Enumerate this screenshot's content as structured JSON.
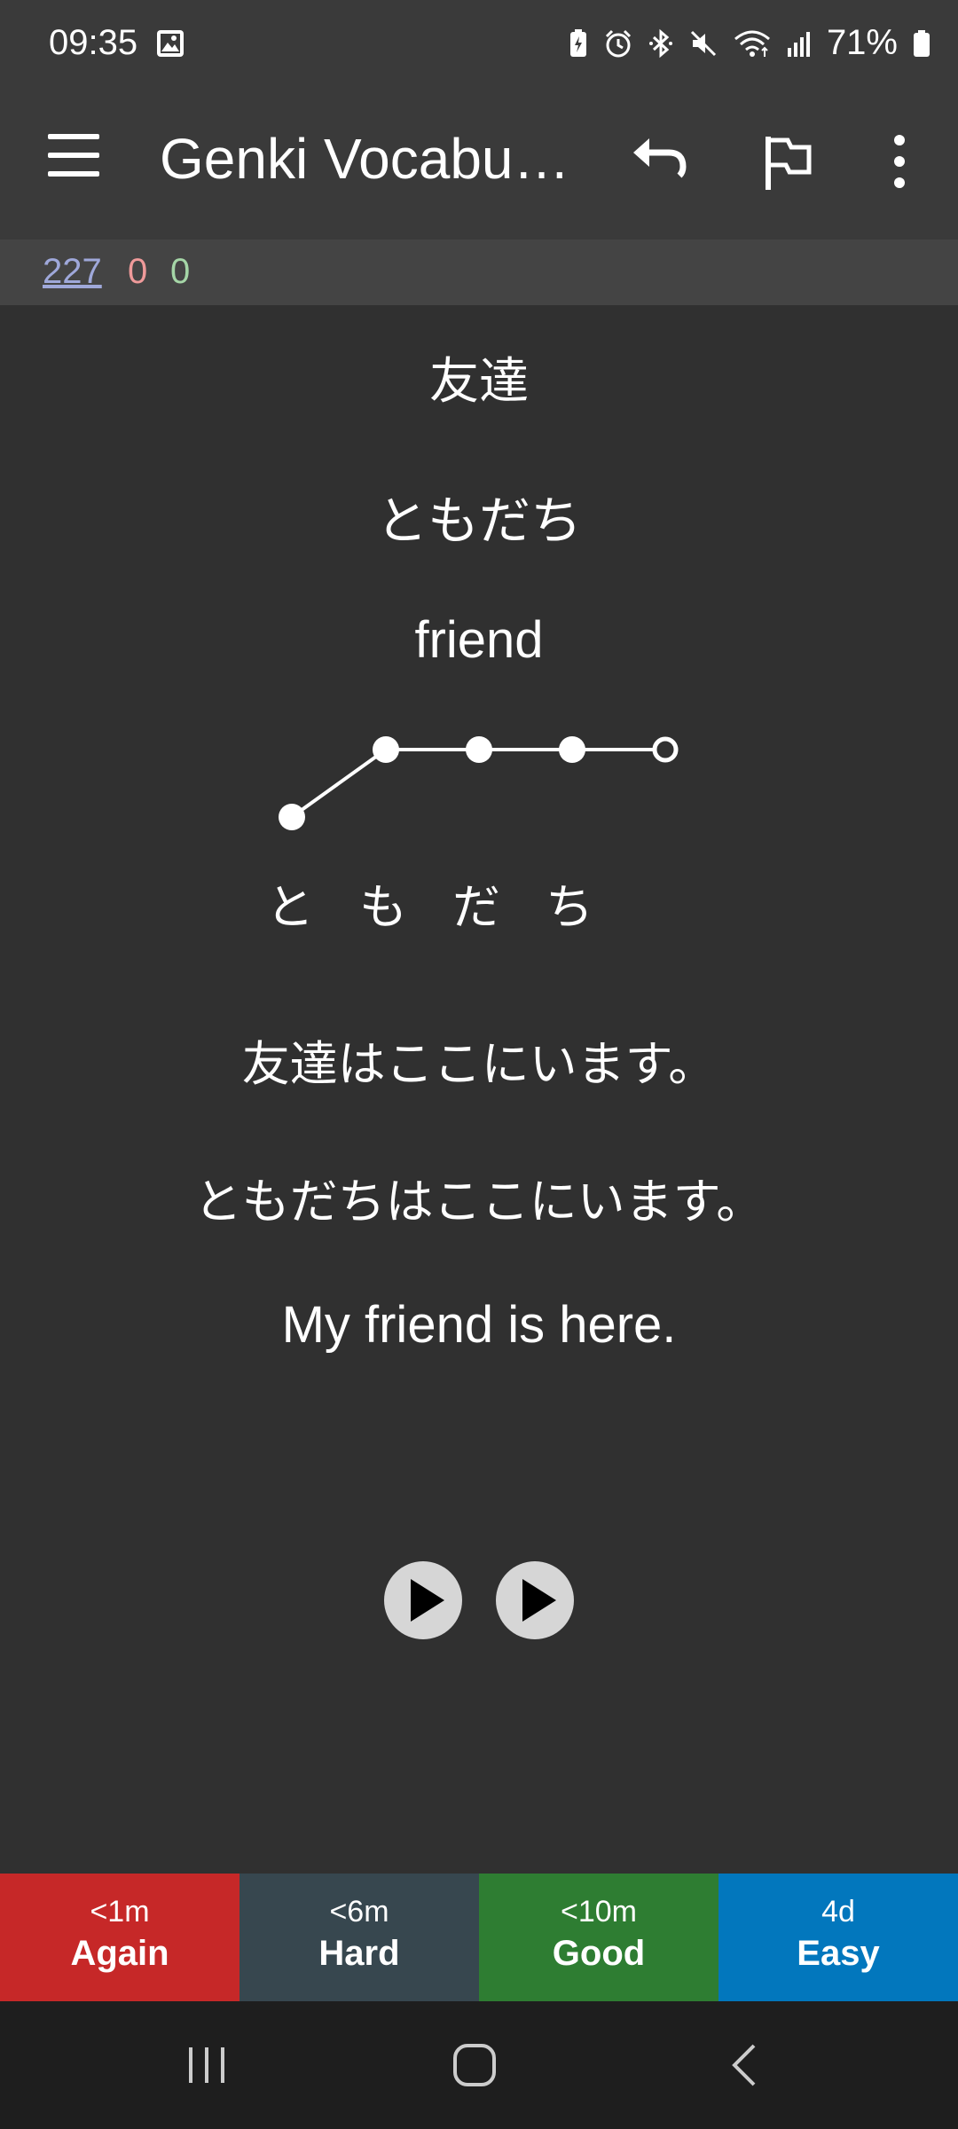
{
  "status_bar": {
    "time": "09:35",
    "battery": "71%",
    "icons": [
      "gallery-icon",
      "battery-saver-icon",
      "alarm-icon",
      "bluetooth-icon",
      "mute-icon",
      "wifi-icon",
      "signal-icon",
      "battery-icon"
    ]
  },
  "toolbar": {
    "title": "Genki Vocabul…",
    "icons": [
      "menu-icon",
      "undo-icon",
      "flag-icon",
      "more-icon"
    ]
  },
  "counts": {
    "new": "227",
    "learning": "0",
    "review": "0",
    "colors": {
      "new": "#9fa8da",
      "learning": "#ef9a9a",
      "review": "#a5d6a7"
    }
  },
  "card": {
    "word": "友達",
    "reading": "ともだち",
    "meaning": "friend",
    "pitch_kana": [
      "と",
      "も",
      "だ",
      "ち"
    ],
    "sentence_jp": "友達はここにいます。",
    "sentence_kana": "ともだちはここにいます。",
    "sentence_en": "My friend is here."
  },
  "answers": [
    {
      "interval": "<1m",
      "label": "Again",
      "color": "#c62828"
    },
    {
      "interval": "<6m",
      "label": "Hard",
      "color": "#37474f"
    },
    {
      "interval": "<10m",
      "label": "Good",
      "color": "#2e7d32"
    },
    {
      "interval": "4d",
      "label": "Easy",
      "color": "#0277bd"
    }
  ],
  "nav": {
    "icons": [
      "recents-icon",
      "home-icon",
      "back-icon"
    ]
  }
}
